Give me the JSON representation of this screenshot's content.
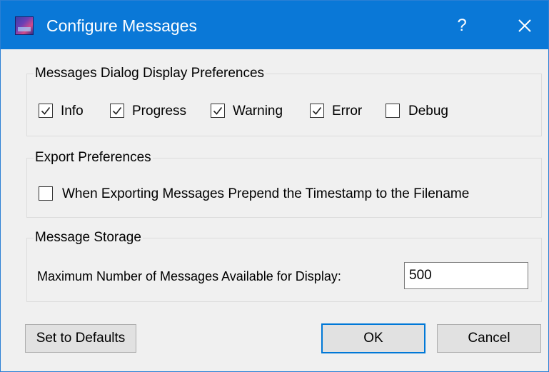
{
  "window": {
    "title": "Configure Messages",
    "help_label": "?",
    "accent_color": "#0a78d7"
  },
  "display_prefs": {
    "group_title": "Messages Dialog Display Preferences",
    "items": [
      {
        "label": "Info",
        "checked": true
      },
      {
        "label": "Progress",
        "checked": true
      },
      {
        "label": "Warning",
        "checked": true
      },
      {
        "label": "Error",
        "checked": true
      },
      {
        "label": "Debug",
        "checked": false
      }
    ]
  },
  "export_prefs": {
    "group_title": "Export Preferences",
    "prepend_timestamp_label": "When Exporting Messages Prepend the Timestamp to the Filename",
    "prepend_timestamp_checked": false
  },
  "storage": {
    "group_title": "Message Storage",
    "max_messages_label": "Maximum Number of Messages Available for Display:",
    "max_messages_value": "500"
  },
  "buttons": {
    "defaults_label": "Set to Defaults",
    "ok_label": "OK",
    "cancel_label": "Cancel"
  },
  "icons": {
    "app": "app-logo-icon",
    "close": "close-icon",
    "check": "checkmark-icon"
  }
}
